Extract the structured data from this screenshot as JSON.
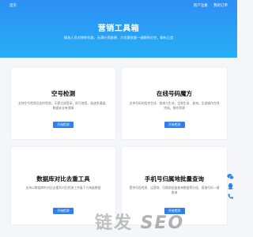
{
  "nav": {
    "home": "首页",
    "register": "新户注册",
    "orders": "我的订单"
  },
  "hero": {
    "title": "营销工具箱",
    "desc": "精准人员对接转化路，无满分思路便，大批量批量—键删掉对空，剩有正道"
  },
  "cards": [
    {
      "title": "空号检测",
      "desc": "支持空号检测及实时检测，无需注册登录，即可使用，极速多通道，数据安全有保障",
      "button": "开始检测"
    },
    {
      "title": "在线号码魔方",
      "desc": "支持号码的组合生成、查询与生成，定制生成、查询，全部操作在线完成，操作简便",
      "button": "开始检测"
    },
    {
      "title": "数据库对比去重工具",
      "desc": "支持以数据库的对比去重到对比检测工作量下方海量数据",
      "button": "开始检测"
    },
    {
      "title": "手机号归属地批量查询",
      "desc": "提供号段检测、运营商、归属地批量查询数据等分组、直辖号码一键查询",
      "button": "开始检测"
    }
  ],
  "side_icons": [
    "wechat-icon",
    "qq-icon",
    "phone-icon"
  ],
  "colors": {
    "hero_top": "#2d8ff5",
    "hero_bottom": "#27aef5",
    "button": "#2f80ed"
  },
  "watermark": {
    "text_main": "链发",
    "text_seo": "SEO"
  }
}
